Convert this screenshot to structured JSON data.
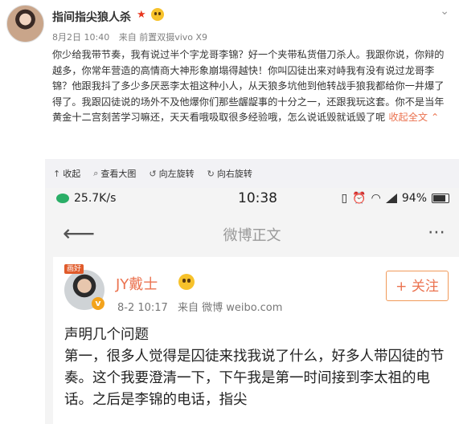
{
  "post": {
    "username": "指间指尖狼人杀",
    "date": "8月2日 10:40",
    "source": "来自 前置双摄vivo X9",
    "body": "你少给我带节奏，我有说过半个字龙哥李锦？好一个夹带私货借刀杀人。我跟你说，你辩的越多，你常年营造的高情商大神形象崩塌得越快！你叫囚徒出来对峙我有没有说过龙哥李锦？他跟我抖了多少多厌恶李太祖这种小人，从天狼多坑他到他转战手狼我都给你一井爆了得了。我跟囚徒说的场外不及他爆你们那些龌龊事的十分之一，还跟我玩这套。你不是当年黄金十二宫刻苦学习嘛还，天天看哦吸取很多经验哦，怎么说诋毁就诋毁了呢",
    "collapse_label": "收起全文 ⌃"
  },
  "toolbar": {
    "items": [
      {
        "label": "收起",
        "icon": "collapse-icon",
        "glyph": "↑"
      },
      {
        "label": "查看大图",
        "icon": "magnify-icon",
        "glyph": "⌕"
      },
      {
        "label": "向左旋转",
        "icon": "rotate-left-icon",
        "glyph": "↺"
      },
      {
        "label": "向右旋转",
        "icon": "rotate-right-icon",
        "glyph": "↻"
      }
    ]
  },
  "phone": {
    "status": {
      "speed": "25.7K/s",
      "time": "10:38",
      "battery": "94%"
    },
    "nav_title": "微博正文",
    "card": {
      "tag": "画好",
      "name": "JY戴士",
      "date": "8-2 10:17",
      "source": "来自 微博 weibo.com",
      "follow_label": "+ 关注",
      "text": "声明几个问题\n第一，很多人觉得是囚徒来找我说了什么，好多人带囚徒的节奏。这个我要澄清一下，下午我是第一时间接到李太祖的电话。之后是李锦的电话，指尖"
    }
  },
  "colors": {
    "accent": "#eb7350",
    "toolbar_bg": "#f2f2f5",
    "meta": "#808080"
  }
}
